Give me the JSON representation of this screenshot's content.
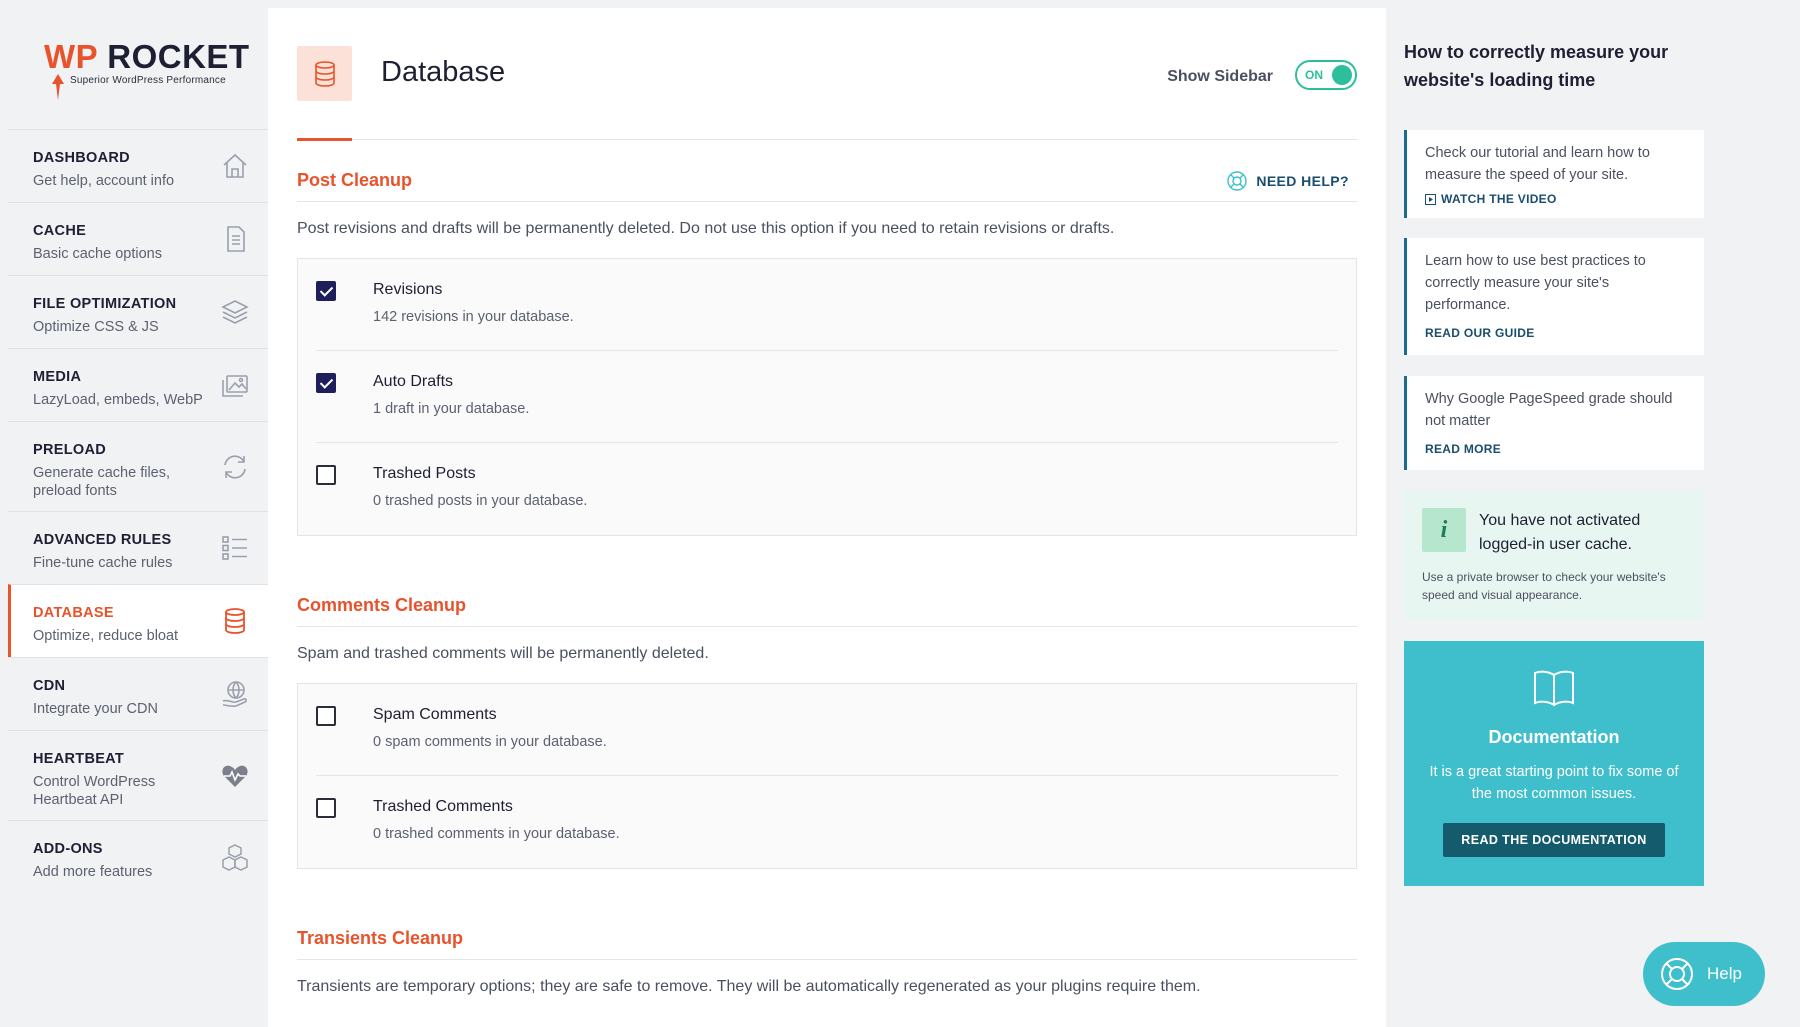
{
  "brand": {
    "logo_wp": "WP",
    "logo_rocket": "ROCKET",
    "tagline": "Superior WordPress Performance",
    "accent_color": "#e8532c",
    "teal_color": "#3fbfcc"
  },
  "sidebar": {
    "items": [
      {
        "title": "DASHBOARD",
        "subtitle": "Get help, account info",
        "icon": "house-icon"
      },
      {
        "title": "CACHE",
        "subtitle": "Basic cache options",
        "icon": "document-icon"
      },
      {
        "title": "FILE OPTIMIZATION",
        "subtitle": "Optimize CSS & JS",
        "icon": "layers-icon"
      },
      {
        "title": "MEDIA",
        "subtitle": "LazyLoad, embeds, WebP",
        "icon": "images-icon"
      },
      {
        "title": "PRELOAD",
        "subtitle": "Generate cache files, preload fonts",
        "icon": "refresh-icon"
      },
      {
        "title": "ADVANCED RULES",
        "subtitle": "Fine-tune cache rules",
        "icon": "list-icon"
      },
      {
        "title": "DATABASE",
        "subtitle": "Optimize, reduce bloat",
        "icon": "database-icon",
        "active": true
      },
      {
        "title": "CDN",
        "subtitle": "Integrate your CDN",
        "icon": "globe-hand-icon"
      },
      {
        "title": "HEARTBEAT",
        "subtitle": "Control WordPress Heartbeat API",
        "icon": "heartbeat-icon"
      },
      {
        "title": "ADD-ONS",
        "subtitle": "Add more features",
        "icon": "cubes-icon"
      }
    ]
  },
  "header": {
    "title": "Database",
    "show_sidebar_label": "Show Sidebar",
    "toggle_label": "ON"
  },
  "sections": {
    "post_cleanup": {
      "title": "Post Cleanup",
      "help_label": "NEED HELP?",
      "description": "Post revisions and drafts will be permanently deleted. Do not use this option if you need to retain revisions or drafts.",
      "options": [
        {
          "label": "Revisions",
          "sub": "142 revisions in your database.",
          "checked": true
        },
        {
          "label": "Auto Drafts",
          "sub": "1 draft in your database.",
          "checked": true
        },
        {
          "label": "Trashed Posts",
          "sub": "0 trashed posts in your database.",
          "checked": false
        }
      ]
    },
    "comments_cleanup": {
      "title": "Comments Cleanup",
      "description": "Spam and trashed comments will be permanently deleted.",
      "options": [
        {
          "label": "Spam Comments",
          "sub": "0 spam comments in your database.",
          "checked": false
        },
        {
          "label": "Trashed Comments",
          "sub": "0 trashed comments in your database.",
          "checked": false
        }
      ]
    },
    "transients_cleanup": {
      "title": "Transients Cleanup",
      "description": "Transients are temporary options; they are safe to remove. They will be automatically regenerated as your plugins require them."
    }
  },
  "right_sidebar": {
    "title": "How to correctly measure your website's loading time",
    "tips": [
      {
        "text": "Check our tutorial and learn how to measure the speed of your site.",
        "link": "WATCH THE VIDEO"
      },
      {
        "text": "Learn how to use best practices to correctly measure your site's performance.",
        "link": "READ OUR GUIDE"
      },
      {
        "text": "Why Google PageSpeed grade should not matter",
        "link": "READ MORE"
      }
    ],
    "notice": {
      "icon_letter": "i",
      "title": "You have not activated logged-in user cache.",
      "text": "Use a private browser to check your website's speed and visual appearance."
    },
    "documentation": {
      "title": "Documentation",
      "text": "It is a great starting point to fix some of the most common issues.",
      "button": "READ THE DOCUMENTATION"
    },
    "help_button": "Help"
  }
}
